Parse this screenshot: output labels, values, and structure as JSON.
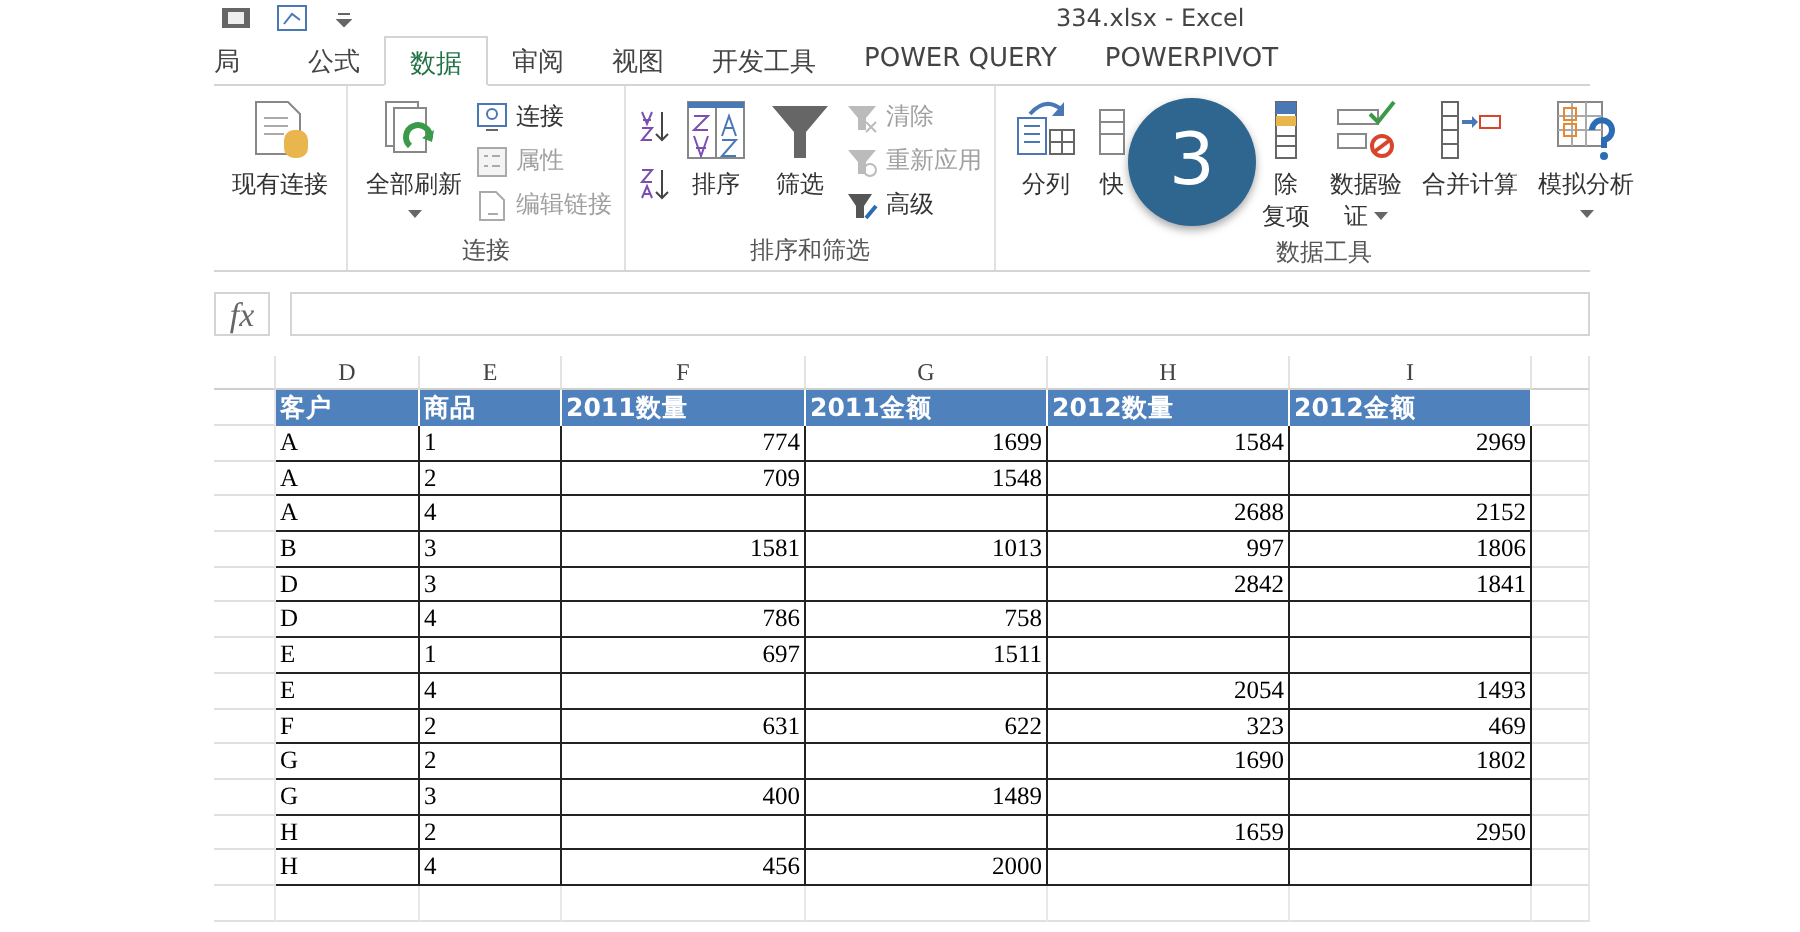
{
  "window": {
    "title": "334.xlsx - Excel"
  },
  "tabs": [
    {
      "label": "局",
      "selected": false
    },
    {
      "label": "公式",
      "selected": false
    },
    {
      "label": "数据",
      "selected": true
    },
    {
      "label": "审阅",
      "selected": false
    },
    {
      "label": "视图",
      "selected": false
    },
    {
      "label": "开发工具",
      "selected": false
    },
    {
      "label": "POWER QUERY",
      "selected": false
    },
    {
      "label": "POWERPIVOT",
      "selected": false
    }
  ],
  "ribbon": {
    "groups": [
      {
        "items": [
          {
            "kind": "large",
            "lines": [
              "现有连接"
            ],
            "dropdown": false
          }
        ]
      },
      {
        "label": "连接",
        "items": [
          {
            "kind": "large",
            "lines": [
              "全部刷新"
            ],
            "dropdown": true
          },
          {
            "kind": "stack",
            "entries": [
              {
                "label": "连接",
                "disabled": false
              },
              {
                "label": "属性",
                "disabled": true
              },
              {
                "label": "编辑链接",
                "disabled": true
              }
            ]
          }
        ]
      },
      {
        "label": "排序和筛选",
        "items": [
          {
            "kind": "sort_pair"
          },
          {
            "kind": "large",
            "lines": [
              "排序"
            ],
            "dropdown": false
          },
          {
            "kind": "large",
            "lines": [
              "筛选"
            ],
            "dropdown": false
          },
          {
            "kind": "stack",
            "entries": [
              {
                "label": "清除",
                "disabled": true
              },
              {
                "label": "重新应用",
                "disabled": true
              },
              {
                "label": "高级",
                "disabled": false
              }
            ]
          }
        ]
      },
      {
        "label": "数据工具",
        "items": [
          {
            "kind": "large",
            "lines": [
              "分列"
            ],
            "dropdown": false
          },
          {
            "kind": "large",
            "lines": [
              "快"
            ],
            "dropdown": false
          },
          {
            "kind": "large",
            "lines": [
              "除",
              "复项"
            ],
            "dropdown": false
          },
          {
            "kind": "large",
            "lines": [
              "数据验",
              "证"
            ],
            "dropdown": true
          },
          {
            "kind": "large",
            "lines": [
              "合并计算"
            ],
            "dropdown": false
          },
          {
            "kind": "large",
            "lines": [
              "模拟分析"
            ],
            "dropdown": true
          }
        ]
      }
    ]
  },
  "step_badge": {
    "label": "3"
  },
  "formula_bar": {
    "label": "fx"
  },
  "sheet": {
    "columns": [
      {
        "letter": "D",
        "header": "客户",
        "numeric": false
      },
      {
        "letter": "E",
        "header": "商品",
        "numeric": false
      },
      {
        "letter": "F",
        "header": "2011数量",
        "numeric": true
      },
      {
        "letter": "G",
        "header": "2011金额",
        "numeric": true
      },
      {
        "letter": "H",
        "header": "2012数量",
        "numeric": true
      },
      {
        "letter": "I",
        "header": "2012金额",
        "numeric": true
      }
    ],
    "rows": [
      [
        "A",
        "1",
        "774",
        "1699",
        "1584",
        "2969"
      ],
      [
        "A",
        "2",
        "709",
        "1548",
        null,
        null
      ],
      [
        "A",
        "4",
        null,
        null,
        "2688",
        "2152"
      ],
      [
        "B",
        "3",
        "1581",
        "1013",
        "997",
        "1806"
      ],
      [
        "D",
        "3",
        null,
        null,
        "2842",
        "1841"
      ],
      [
        "D",
        "4",
        "786",
        "758",
        null,
        null
      ],
      [
        "E",
        "1",
        "697",
        "1511",
        null,
        null
      ],
      [
        "E",
        "4",
        null,
        null,
        "2054",
        "1493"
      ],
      [
        "F",
        "2",
        "631",
        "622",
        "323",
        "469"
      ],
      [
        "G",
        "2",
        null,
        null,
        "1690",
        "1802"
      ],
      [
        "G",
        "3",
        "400",
        "1489",
        null,
        null
      ],
      [
        "H",
        "2",
        null,
        null,
        "1659",
        "2950"
      ],
      [
        "H",
        "4",
        "456",
        "2000",
        null,
        null
      ]
    ]
  }
}
